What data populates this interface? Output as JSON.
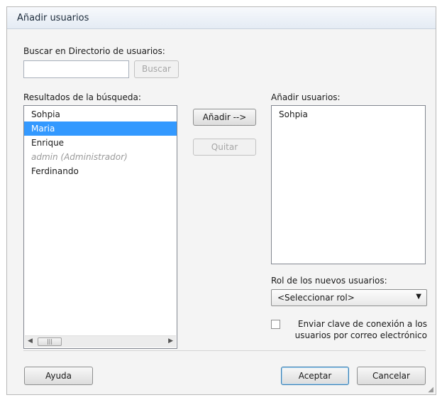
{
  "dialog": {
    "title": "Añadir usuarios"
  },
  "search": {
    "label": "Buscar en Directorio de usuarios:",
    "value": "",
    "placeholder": "",
    "button": "Buscar"
  },
  "results": {
    "label": "Resultados de la búsqueda:",
    "items": [
      {
        "text": "Sohpia",
        "state": "normal"
      },
      {
        "text": "Maria",
        "state": "selected"
      },
      {
        "text": "Enrique",
        "state": "normal"
      },
      {
        "text": "admin (Administrador)",
        "state": "disabled"
      },
      {
        "text": "Ferdinando",
        "state": "normal"
      }
    ]
  },
  "actions": {
    "add": "Añadir -->",
    "remove": "Quitar"
  },
  "added": {
    "label": "Añadir usuarios:",
    "items": [
      "Sohpia"
    ]
  },
  "role": {
    "label": "Rol de los nuevos usuarios:",
    "selected": "<Seleccionar rol>"
  },
  "email": {
    "checked": false,
    "line1": "Enviar clave de conexión a los",
    "line2": "usuarios por correo electrónico"
  },
  "footer": {
    "help": "Ayuda",
    "ok": "Aceptar",
    "cancel": "Cancelar"
  },
  "colors": {
    "selection": "#3399ff",
    "default_button_border": "#3c7fb1"
  }
}
